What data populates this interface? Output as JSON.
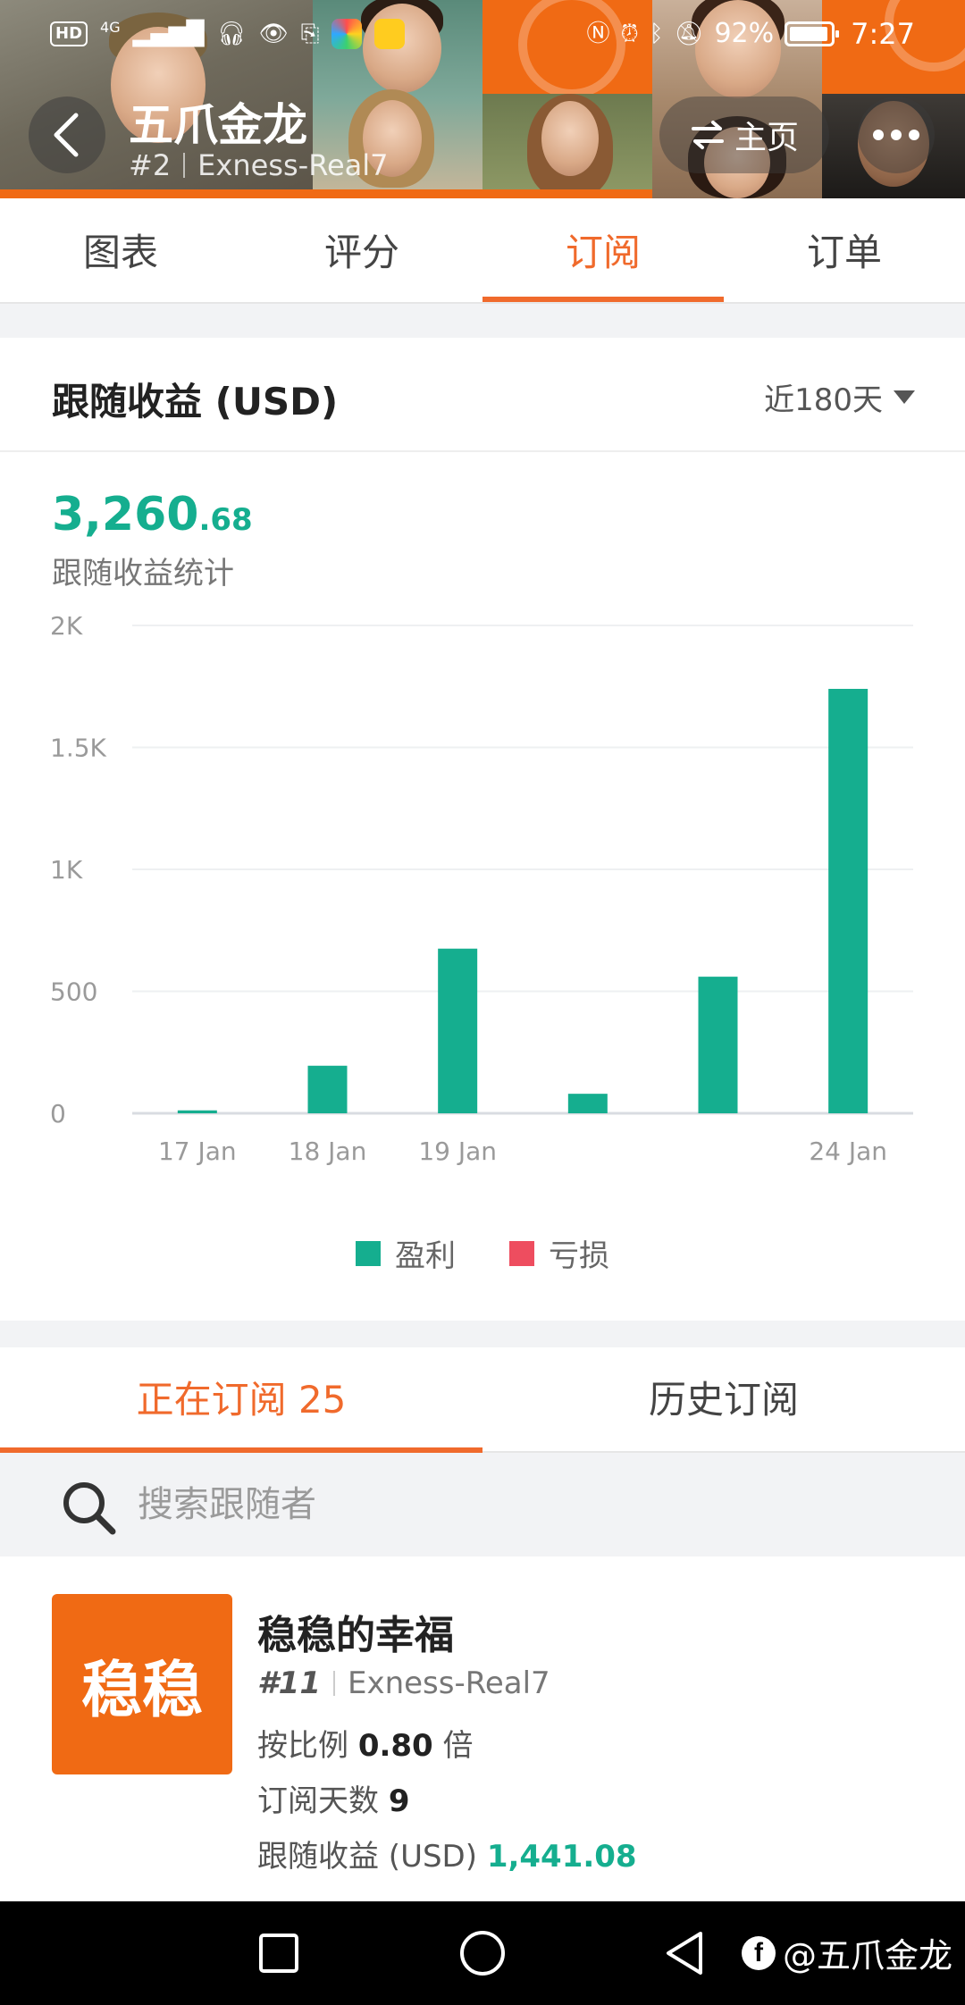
{
  "status_bar": {
    "hd_label": "HD",
    "network": "4G",
    "battery": "92%",
    "time": "7:27"
  },
  "header": {
    "title": "五爪金龙",
    "rank": "#2",
    "account": "Exness-Real7",
    "home_label": "主页"
  },
  "main_tabs": [
    {
      "label": "图表",
      "active": false
    },
    {
      "label": "评分",
      "active": false
    },
    {
      "label": "订阅",
      "active": true
    },
    {
      "label": "订单",
      "active": false
    }
  ],
  "earnings": {
    "title": "跟随收益 (USD)",
    "range": "近180天",
    "total_int": "3,260",
    "total_dec": ".68",
    "total_label": "跟随收益统计"
  },
  "chart_data": {
    "type": "bar",
    "categories": [
      "17 Jan",
      "18 Jan",
      "19 Jan",
      "",
      "",
      "24 Jan"
    ],
    "series": [
      {
        "name": "盈利",
        "color": "#15ae8f",
        "values": [
          12,
          195,
          675,
          80,
          560,
          1740
        ]
      },
      {
        "name": "亏损",
        "color": "#ee4d5f",
        "values": [
          0,
          0,
          0,
          0,
          0,
          0
        ]
      }
    ],
    "y_ticks": [
      "0",
      "500",
      "1K",
      "1.5K",
      "2K"
    ],
    "ylim": [
      0,
      2000
    ],
    "grid": true,
    "legend": "bottom"
  },
  "subscriptions": {
    "tabs": [
      {
        "label": "正在订阅 25",
        "active": true
      },
      {
        "label": "历史订阅",
        "active": false
      }
    ],
    "search_placeholder": "搜索跟随者",
    "items": [
      {
        "avatar_text": "稳稳",
        "name": "稳稳的幸福",
        "rank": "#11",
        "account": "Exness-Real7",
        "ratio_label": "按比例",
        "ratio_value": "0.80",
        "ratio_unit": "倍",
        "days_label": "订阅天数",
        "days_value": "9",
        "profit_label": "跟随收益 (USD)",
        "profit_value": "1,441.08"
      }
    ]
  },
  "watermark": {
    "logo": "f",
    "text": "@五爪金龙"
  }
}
